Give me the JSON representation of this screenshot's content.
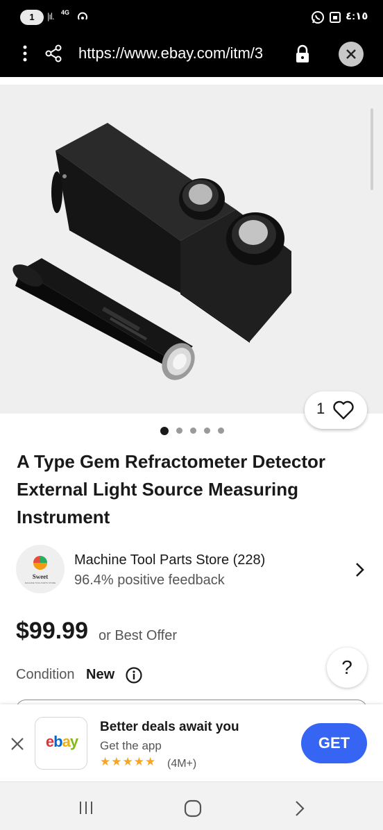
{
  "status_bar": {
    "sim_label": "1",
    "network_label": "4G",
    "clock": "٤:١٥"
  },
  "browser": {
    "url": "https://www.ebay.com/itm/3"
  },
  "product": {
    "watch_count": "1",
    "image_pages": 5,
    "active_page": 1,
    "title": "A Type Gem Refractometer Detector External Light Source Measuring Instrument"
  },
  "seller": {
    "logo_text": "Sweet",
    "logo_subtext": "MACHINE TOOL PARTS STORE",
    "name": "Machine Tool Parts Store (228)",
    "feedback": "96.4% positive feedback"
  },
  "price": {
    "amount": "$99.99",
    "offer_text": "or Best Offer"
  },
  "condition": {
    "label": "Condition",
    "value": "New"
  },
  "help_label": "?",
  "app_banner": {
    "app_logo": "ebay",
    "title": "Better deals await you",
    "subtitle": "Get the app",
    "stars": "★★★★★",
    "rating_count": "(4M+)",
    "cta": "GET"
  },
  "colors": {
    "ebay_blue": "#3665f3",
    "star_gold": "#f5a623",
    "logo_e": "#e53238",
    "logo_b": "#0064d2",
    "logo_a": "#f5af02",
    "logo_y": "#86b817"
  }
}
